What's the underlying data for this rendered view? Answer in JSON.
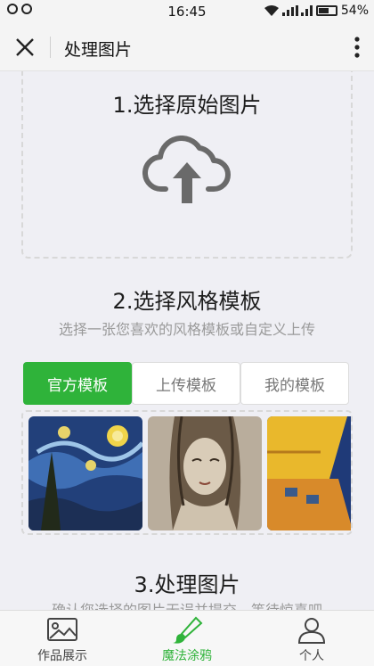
{
  "statusbar": {
    "time": "16:45",
    "battery": "54%"
  },
  "header": {
    "title": "处理图片"
  },
  "steps": {
    "step1_title": "1.选择原始图片",
    "step2_title": "2.选择风格模板",
    "step2_subtitle": "选择一张您喜欢的风格模板或自定义上传",
    "step3_title": "3.处理图片",
    "step3_subtitle": "确认您选择的图片无误并提交，等待惊喜吧"
  },
  "tabs": [
    {
      "label": "官方模板",
      "active": true
    },
    {
      "label": "上传模板",
      "active": false
    },
    {
      "label": "我的模板",
      "active": false
    }
  ],
  "thumbnails": [
    "starry-night",
    "portrait-sketch",
    "cafe-terrace"
  ],
  "bottom_nav": [
    {
      "label": "作品展示",
      "icon": "gallery-icon",
      "active": false
    },
    {
      "label": "魔法涂鸦",
      "icon": "brush-icon",
      "active": true
    },
    {
      "label": "个人",
      "icon": "person-icon",
      "active": false
    }
  ],
  "colors": {
    "accent": "#2fb33a",
    "muted_text": "#9a9a9a",
    "background": "#efeff4"
  }
}
